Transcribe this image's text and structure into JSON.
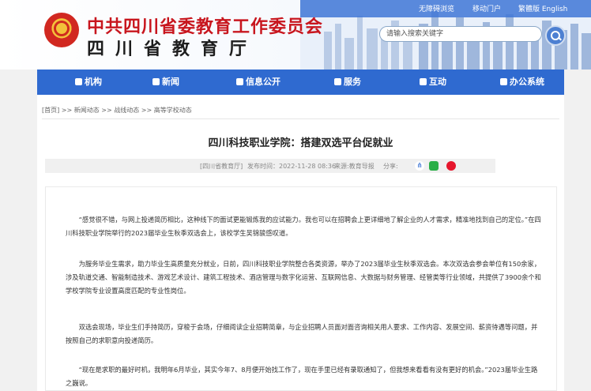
{
  "header": {
    "title_main": "中共四川省委教育工作委员会",
    "title_sub": "四川省教育厅",
    "top_links": [
      "无障碍浏览",
      "移动门户",
      "繁體版 English"
    ],
    "search_placeholder": "请输入搜索关键字"
  },
  "nav": {
    "items": [
      "机构",
      "新闻",
      "信息公开",
      "服务",
      "互动",
      "办公系统"
    ]
  },
  "breadcrumb": "[首页] >> 新闻动态 >> 战线动态 >> 高等学校动态",
  "article": {
    "title": "四川科技职业学院：搭建双选平台促就业",
    "meta_source": "[四川省教育厅]",
    "meta_date": "发布时间：2022-11-28 08:36",
    "meta_from": "来源:教育导报",
    "meta_share": "分享:",
    "paragraphs": [
      "“感觉很不错，与网上投递简历相比，这种线下的面试更能锻炼我的应试能力。我也可以在招聘会上更详细地了解企业的人才需求，精准地找到自己的定位。”在四川科技职业学院举行的2023届毕业生秋季双选会上，该校学生吴锦骏感叹道。",
      "为服务毕业生需求，助力毕业生高质量充分就业，日前，四川科技职业学院整合各类资源，举办了2023届毕业生秋季双选会。本次双选会参会单位有150余家，涉及轨道交通、智能制造技术、游戏艺术设计、建筑工程技术、酒店管理与数字化运营、互联网信息、大数据与财务管理、经管类等行业领域，共提供了3900余个和学校学院专业设置高度匹配的专业性岗位。",
      "双选会现场，毕业生们手持简历，穿梭于会场，仔细阅读企业招聘简章，与企业招聘人员面对面咨询相关用人要求、工作内容、发展空间、薪资待遇等问题，并按照自己的求职意向投递简历。",
      "“现在是求职的最好时机，我明年6月毕业，其实今年7、8月便开始找工作了，现在手里已经有录取通知了，但我想来看看有没有更好的机会。”2023届毕业生路之巍说。"
    ]
  }
}
